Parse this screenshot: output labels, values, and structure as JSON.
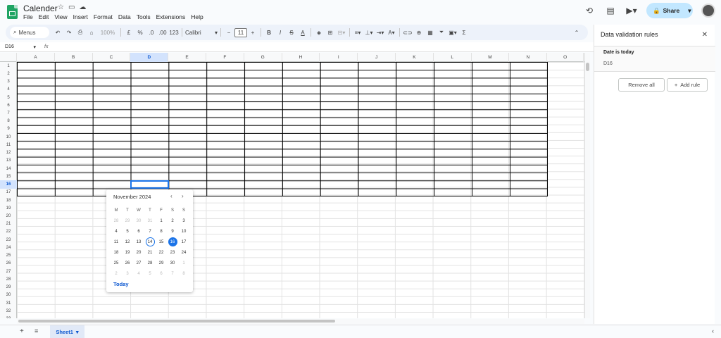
{
  "app": {
    "title": "Calender"
  },
  "menus": [
    "File",
    "Edit",
    "View",
    "Insert",
    "Format",
    "Data",
    "Tools",
    "Extensions",
    "Help"
  ],
  "header": {
    "share_label": "Share"
  },
  "toolbar": {
    "menus_label": "Menus",
    "zoom": "100%",
    "currency": "£",
    "percent": "%",
    "dec_decrease": ".0",
    "dec_increase": ".00",
    "number_format": "123",
    "font": "Calibri",
    "font_size": "11"
  },
  "formula_bar": {
    "cell_ref": "D16",
    "fx": "fx"
  },
  "columns": [
    "A",
    "B",
    "C",
    "D",
    "E",
    "F",
    "G",
    "H",
    "I",
    "J",
    "K",
    "L",
    "M",
    "N",
    "O"
  ],
  "selected_column": "D",
  "rows": [
    "1",
    "2",
    "3",
    "4",
    "5",
    "6",
    "7",
    "8",
    "9",
    "10",
    "11",
    "12",
    "13",
    "14",
    "15",
    "16",
    "17",
    "18",
    "19",
    "20",
    "21",
    "22",
    "23",
    "24",
    "25",
    "26",
    "27",
    "28",
    "29",
    "30",
    "31",
    "32",
    "33"
  ],
  "selected_row": "16",
  "calendar": {
    "title": "November 2024",
    "prev": "‹",
    "next": "›",
    "weekdays": [
      "M",
      "T",
      "W",
      "T",
      "F",
      "S",
      "S"
    ],
    "days": [
      {
        "d": "28",
        "out": true
      },
      {
        "d": "29",
        "out": true
      },
      {
        "d": "30",
        "out": true
      },
      {
        "d": "31",
        "out": true
      },
      {
        "d": "1"
      },
      {
        "d": "2"
      },
      {
        "d": "3"
      },
      {
        "d": "4"
      },
      {
        "d": "5"
      },
      {
        "d": "6"
      },
      {
        "d": "7"
      },
      {
        "d": "8"
      },
      {
        "d": "9"
      },
      {
        "d": "10"
      },
      {
        "d": "11"
      },
      {
        "d": "12"
      },
      {
        "d": "13"
      },
      {
        "d": "14",
        "today": true
      },
      {
        "d": "15"
      },
      {
        "d": "16",
        "selected": true
      },
      {
        "d": "17"
      },
      {
        "d": "18"
      },
      {
        "d": "19"
      },
      {
        "d": "20"
      },
      {
        "d": "21"
      },
      {
        "d": "22"
      },
      {
        "d": "23"
      },
      {
        "d": "24"
      },
      {
        "d": "25"
      },
      {
        "d": "26"
      },
      {
        "d": "27"
      },
      {
        "d": "28"
      },
      {
        "d": "29"
      },
      {
        "d": "30"
      },
      {
        "d": "1",
        "out": true
      },
      {
        "d": "2",
        "out": true
      },
      {
        "d": "3",
        "out": true
      },
      {
        "d": "4",
        "out": true
      },
      {
        "d": "5",
        "out": true
      },
      {
        "d": "6",
        "out": true
      },
      {
        "d": "7",
        "out": true
      },
      {
        "d": "8",
        "out": true
      }
    ],
    "today_label": "Today"
  },
  "panel": {
    "title": "Data validation rules",
    "rule_name": "Date is today",
    "rule_range": "D16",
    "remove_all": "Remove all",
    "add_rule": "Add rule"
  },
  "sheets": {
    "active": "Sheet1"
  },
  "colors": {
    "accent": "#1a73e8",
    "share_bg": "#c2e7ff",
    "sheets_green": "#1fa463"
  }
}
